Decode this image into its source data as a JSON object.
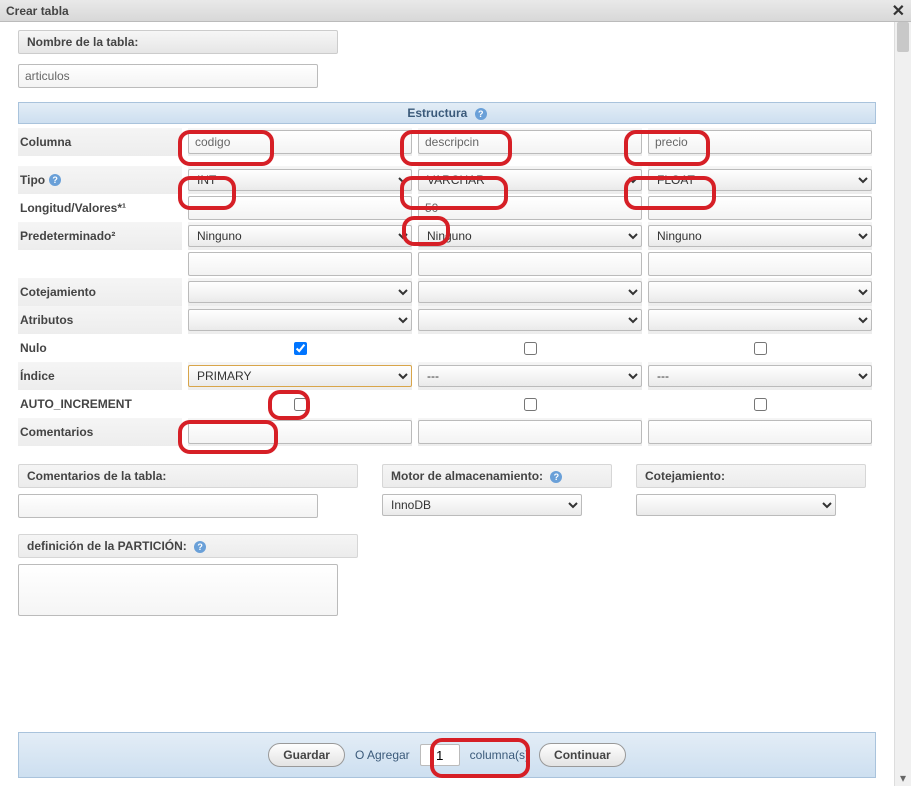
{
  "window": {
    "title": "Crear tabla"
  },
  "tableNameLabel": "Nombre de la tabla:",
  "tableNameValue": "articulos",
  "structureHeader": "Estructura",
  "labels": {
    "columna": "Columna",
    "tipo": "Tipo",
    "longitud": "Longitud/Valores*¹",
    "predeterminado": "Predeterminado²",
    "cotejamiento": "Cotejamiento",
    "atributos": "Atributos",
    "nulo": "Nulo",
    "indice": "Índice",
    "autoinc": "AUTO_INCREMENT",
    "comentarios": "Comentarios"
  },
  "cols": [
    {
      "name": "codigo",
      "type": "INT",
      "length": "",
      "default": "Ninguno",
      "collation": "",
      "attr": "",
      "null": true,
      "index": "PRIMARY",
      "autoinc": false,
      "comment": ""
    },
    {
      "name": "descripcin",
      "type": "VARCHAR",
      "length": "50",
      "default": "Ninguno",
      "collation": "",
      "attr": "",
      "null": false,
      "index": "---",
      "autoinc": false,
      "comment": ""
    },
    {
      "name": "precio",
      "type": "FLOAT",
      "length": "",
      "default": "Ninguno",
      "collation": "",
      "attr": "",
      "null": false,
      "index": "---",
      "autoinc": false,
      "comment": ""
    }
  ],
  "bottom": {
    "tableComments": "Comentarios de la tabla:",
    "storage": "Motor de almacenamiento:",
    "storageValue": "InnoDB",
    "collation": "Cotejamiento:",
    "partition": "definición de la PARTICIÓN:"
  },
  "footer": {
    "save": "Guardar",
    "or": "O Agregar",
    "count": "1",
    "colword": "columna(s)",
    "continue": "Continuar"
  }
}
